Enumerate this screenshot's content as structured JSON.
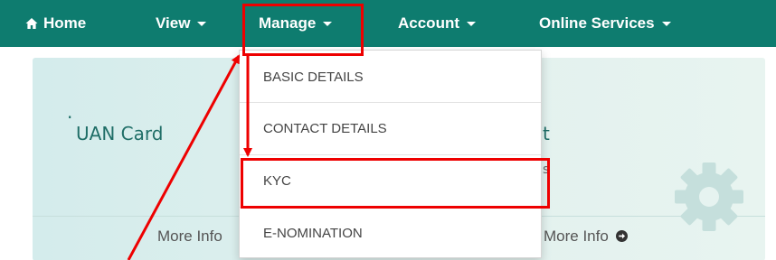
{
  "navbar": {
    "home": "Home",
    "items": [
      "View",
      "Manage",
      "Account",
      "Online Services"
    ]
  },
  "manage_menu": {
    "items": [
      "BASIC DETAILS",
      "CONTACT DETAILS",
      "KYC",
      "E-NOMINATION"
    ]
  },
  "dashboard": {
    "uan_card_title": "UAN Card",
    "partial_title_visible": "t",
    "partial_sub_visible": "s",
    "dot": ".",
    "more_info_left": "More Info",
    "more_info_right": "More Info"
  },
  "colors": {
    "navbar": "#0e7c6f",
    "annotation": "#ee0000",
    "panel": "#d4ecec",
    "gear": "#c5dfdc"
  },
  "icons": [
    "home-icon",
    "caret-down-icon",
    "arrow-right-circle-icon",
    "gear-icon"
  ]
}
